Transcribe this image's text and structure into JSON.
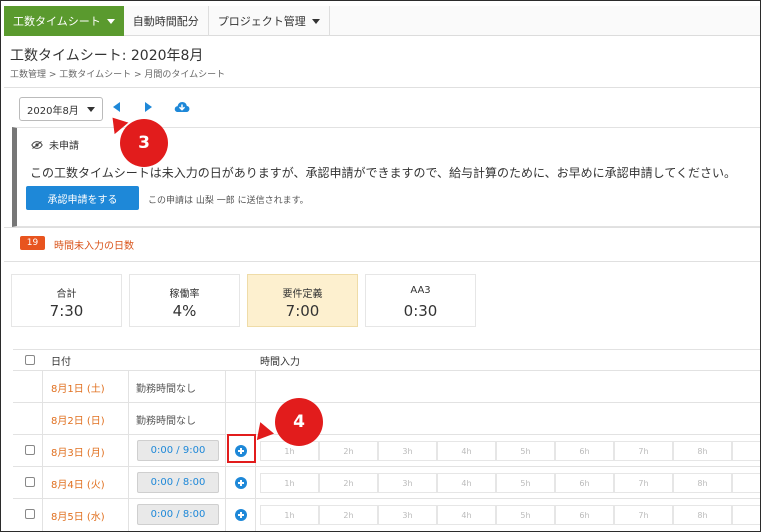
{
  "nav": {
    "tabs": [
      {
        "label": "工数タイムシート",
        "has_caret": true,
        "active": true
      },
      {
        "label": "自動時間配分",
        "has_caret": false,
        "active": false
      },
      {
        "label": "プロジェクト管理",
        "has_caret": true,
        "active": false
      }
    ]
  },
  "page": {
    "title": "工数タイムシート: 2020年8月",
    "breadcrumb": "工数管理 > 工数タイムシート > 月間のタイムシート"
  },
  "toolbar": {
    "month_value": "2020年8月",
    "icons": [
      "chevron-left-icon",
      "chevron-right-icon",
      "cloud-download-icon"
    ]
  },
  "notice": {
    "status": "未申請",
    "message": "この工数タイムシートは未入力の日がありますが、承認申請ができますので、給与計算のために、お早めに承認申請してください。",
    "submit_label": "承認申請をする",
    "note": "この申請は 山梨 一郎 に送信されます。"
  },
  "missing": {
    "count": "19",
    "label": "時間未入力の日数"
  },
  "stats": [
    {
      "label": "合計",
      "value": "7:30",
      "highlight": false
    },
    {
      "label": "稼働率",
      "value": "4%",
      "highlight": false
    },
    {
      "label": "要件定義",
      "value": "7:00",
      "highlight": true
    },
    {
      "label": "AA3",
      "value": "0:30",
      "highlight": false
    }
  ],
  "grid": {
    "header_date": "日付",
    "header_time": "時間入力",
    "hour_labels": [
      "1h",
      "2h",
      "3h",
      "4h",
      "5h",
      "6h",
      "7h",
      "8h"
    ],
    "rows": [
      {
        "date": "8月1日 (土)",
        "no_work": "勤務時間なし",
        "checkbox": false
      },
      {
        "date": "8月2日 (日)",
        "no_work": "勤務時間なし",
        "checkbox": false
      },
      {
        "date": "8月3日 (月)",
        "time": "0:00 / 9:00",
        "checkbox": true
      },
      {
        "date": "8月4日 (火)",
        "time": "0:00 / 8:00",
        "checkbox": true
      },
      {
        "date": "8月5日 (水)",
        "time": "0:00 / 8:00",
        "checkbox": true
      }
    ]
  },
  "annotations": {
    "callout_3": "3",
    "callout_4": "4"
  },
  "colors": {
    "brand_green": "#5a9a2e",
    "primary_blue": "#1e88d8",
    "alert_orange": "#e8541f",
    "callout_red": "#e21c1c",
    "highlight_card": "#fdf0cf"
  }
}
